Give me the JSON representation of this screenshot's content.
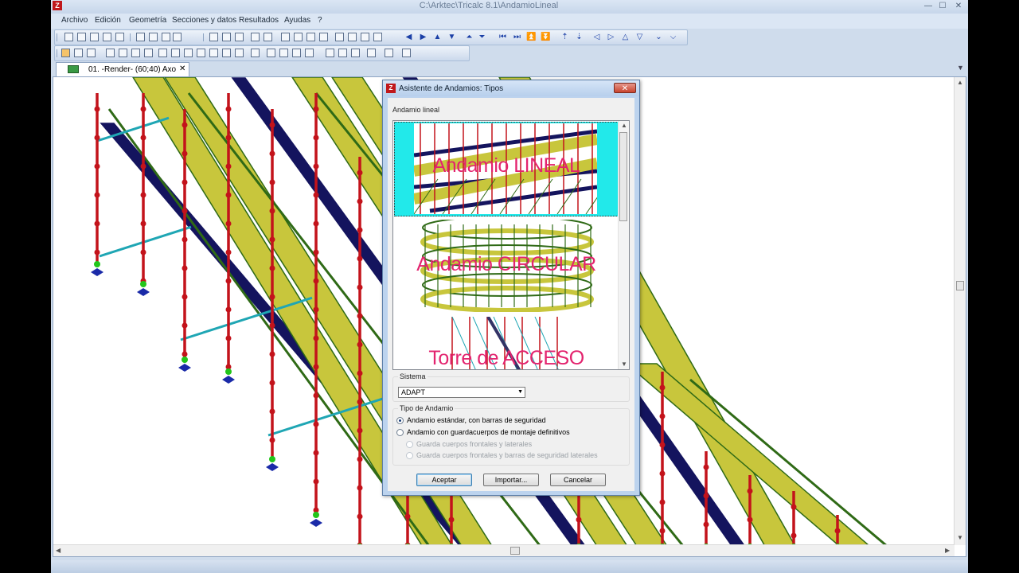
{
  "window": {
    "title": "C:\\Arktec\\Tricalc 8.1\\AndamioLineal",
    "app_icon": "Z",
    "minimize": "—",
    "maximize": "☐",
    "close": "✕"
  },
  "menu": [
    "Archivo",
    "Edición",
    "Geometría",
    "Secciones y datos",
    "Resultados",
    "Ayudas",
    "?"
  ],
  "document_tab": {
    "label": "01. -Render-  (60;40)  Axo",
    "close": "✕",
    "menu_arrow": "▼"
  },
  "dialog": {
    "title": "Asistente de Andamios: Tipos",
    "close": "✕",
    "section_label": "Andamio lineal",
    "previews": [
      {
        "caption": "Andamio LINEAL",
        "selected": true
      },
      {
        "caption": "Andamio CIRCULAR",
        "selected": false
      },
      {
        "caption": "Torre de ACCESO",
        "selected": false
      }
    ],
    "sistema": {
      "legend": "Sistema",
      "selected": "ADAPT",
      "arrow": "▼"
    },
    "tipo": {
      "legend": "Tipo de Andamio",
      "options": [
        {
          "label": "Andamio estándar, con barras de seguridad",
          "checked": true,
          "enabled": true
        },
        {
          "label": "Andamio con guardacuerpos de montaje definitivos",
          "checked": false,
          "enabled": true
        },
        {
          "label": "Guarda cuerpos frontales y laterales",
          "checked": false,
          "enabled": false
        },
        {
          "label": "Guarda cuerpos frontales y barras de seguridad laterales",
          "checked": false,
          "enabled": false
        }
      ]
    },
    "buttons": {
      "accept": "Aceptar",
      "import": "Importar...",
      "cancel": "Cancelar"
    }
  },
  "colors": {
    "plank_yellow": "#c8c63c",
    "plank_green": "#2f6a16",
    "beam_navy": "#14145e",
    "post_red": "#c3131b",
    "node_green": "#22c51a",
    "brace_cyan": "#1fa6b4",
    "base_blue": "#1a2aa8",
    "caption_pink": "#e3236e",
    "preview_cyan": "#22e9ea"
  }
}
